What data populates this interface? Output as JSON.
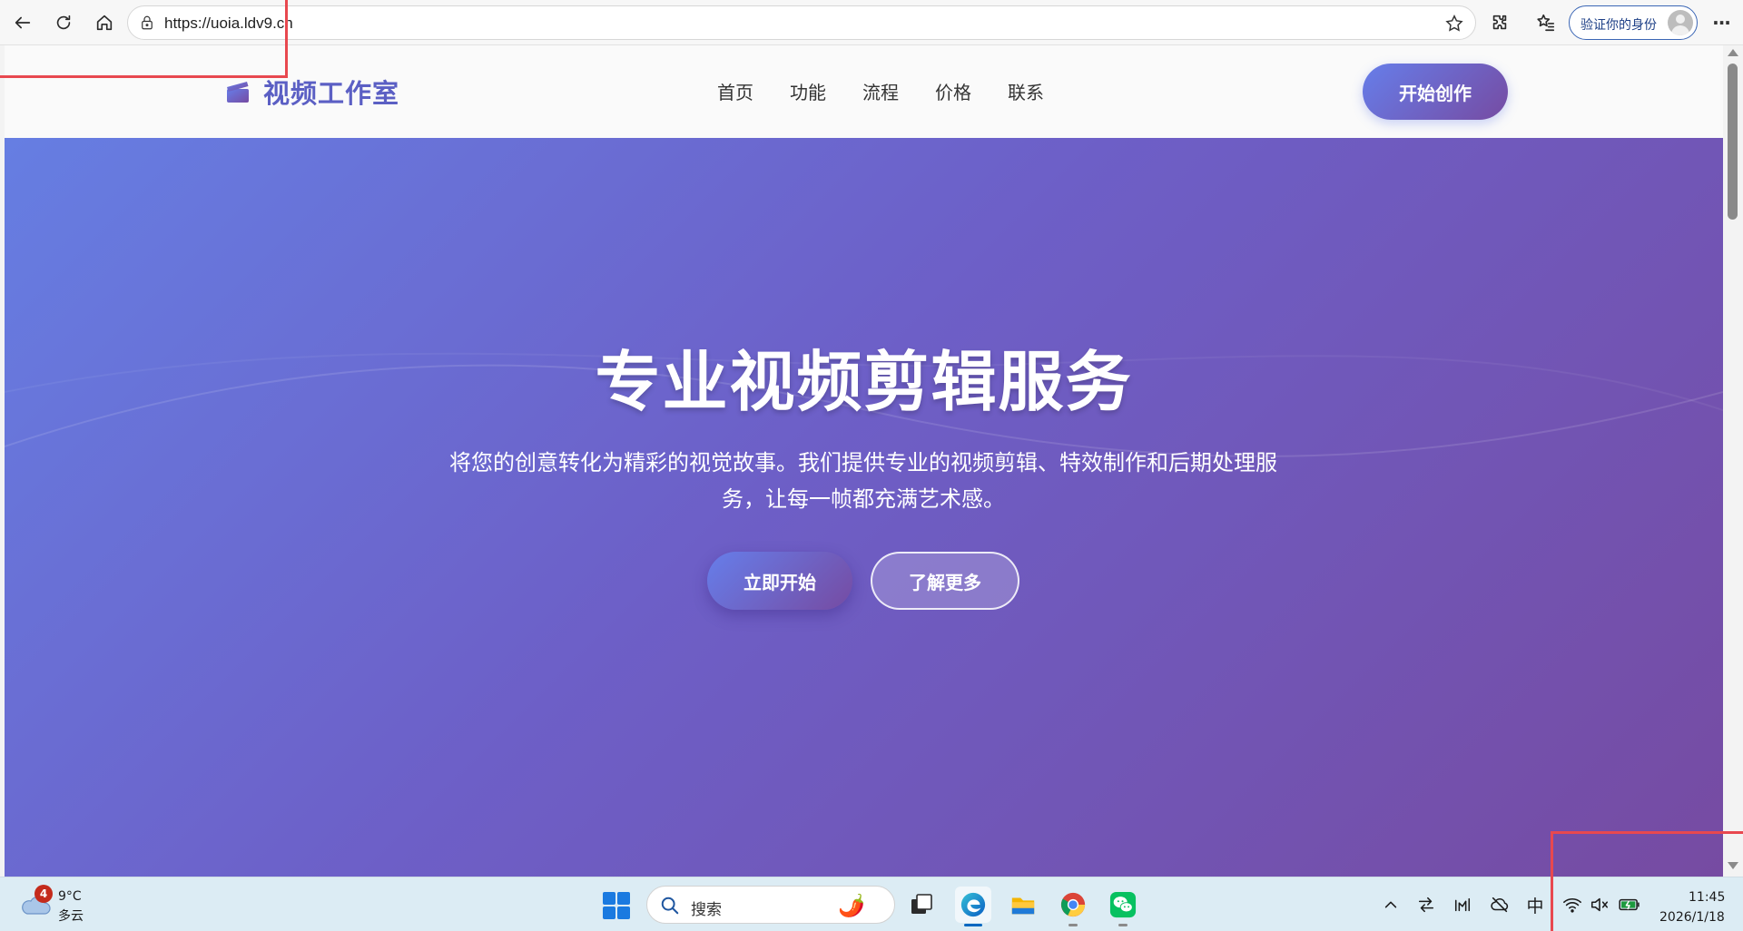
{
  "browser": {
    "url": "https://uoia.ldv9.cn",
    "profile_label": "验证你的身份",
    "more_label": "···"
  },
  "site": {
    "logo_text": "视频工作室",
    "nav": [
      "首页",
      "功能",
      "流程",
      "价格",
      "联系"
    ],
    "cta_label": "开始创作",
    "brand_gradient": [
      "#667eea",
      "#764ba2"
    ]
  },
  "hero": {
    "title": "专业视频剪辑服务",
    "description": "将您的创意转化为精彩的视觉故事。我们提供专业的视频剪辑、特效制作和后期处理服务，让每一帧都充满艺术感。",
    "primary_button": "立即开始",
    "secondary_button": "了解更多"
  },
  "taskbar": {
    "weather_badge": "4",
    "weather_temp": "9°C",
    "weather_condition": "多云",
    "search_placeholder": "搜索",
    "search_decoration": "🌶️",
    "ime_label": "中",
    "time": "11:45",
    "date": "2026/1/18",
    "apps": [
      "task-view-icon",
      "edge-icon",
      "file-explorer-icon",
      "chrome-icon",
      "wechat-icon"
    ]
  }
}
